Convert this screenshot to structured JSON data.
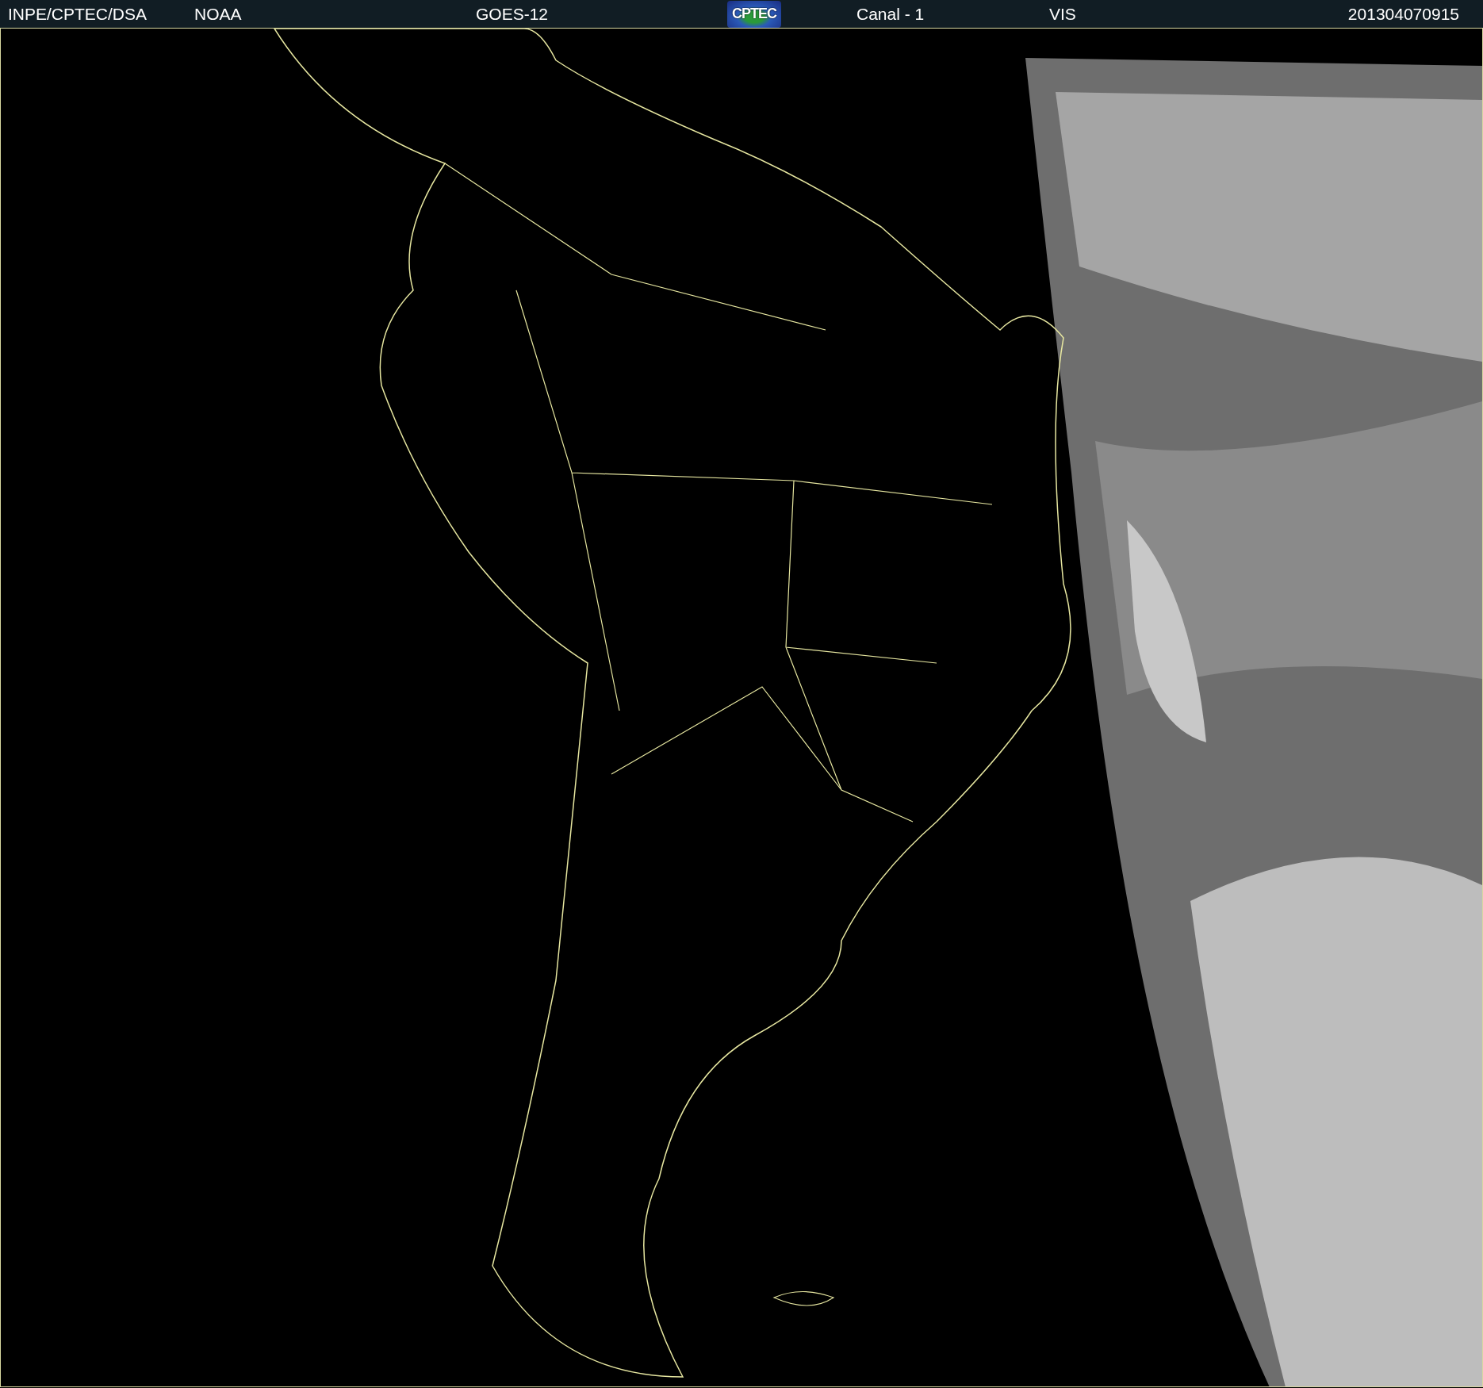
{
  "header": {
    "items": [
      {
        "kind": "text",
        "text": "INPE/CPTEC/DSA"
      },
      {
        "kind": "text",
        "text": "NOAA"
      },
      {
        "kind": "text",
        "text": "GOES-12"
      },
      {
        "kind": "logo",
        "text": "CPTEC"
      },
      {
        "kind": "text",
        "text": "Canal - 1"
      },
      {
        "kind": "text",
        "text": "VIS"
      },
      {
        "kind": "text",
        "text": "201304070915"
      }
    ]
  }
}
